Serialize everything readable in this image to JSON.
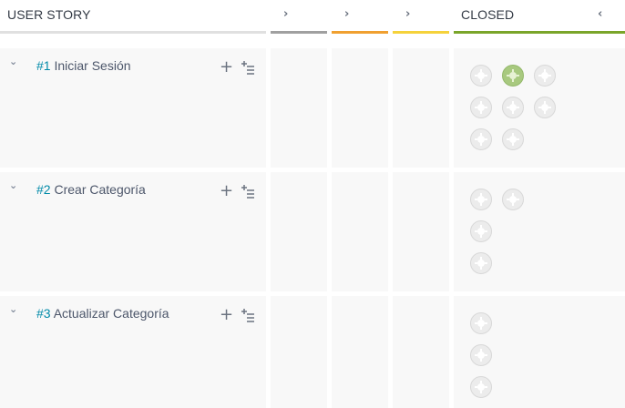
{
  "header": {
    "user_story_label": "USER STORY",
    "closed_label": "CLOSED",
    "status_colors": [
      "#a0a0a0",
      "#f0a030",
      "#f5d23b",
      "#7aa52a"
    ]
  },
  "rows": [
    {
      "ref": "#1",
      "title": "Iniciar Sesión",
      "avatars": 8
    },
    {
      "ref": "#2",
      "title": "Crear Categoría",
      "avatars": 4
    },
    {
      "ref": "#3",
      "title": "Actualizar Categoría",
      "avatars": 3
    }
  ],
  "icons": {
    "collapse": "chevron-down-icon",
    "add": "plus-icon",
    "bulk": "add-bulk-icon",
    "expand": "chevron-right-icon",
    "fold": "chevron-left-icon"
  }
}
